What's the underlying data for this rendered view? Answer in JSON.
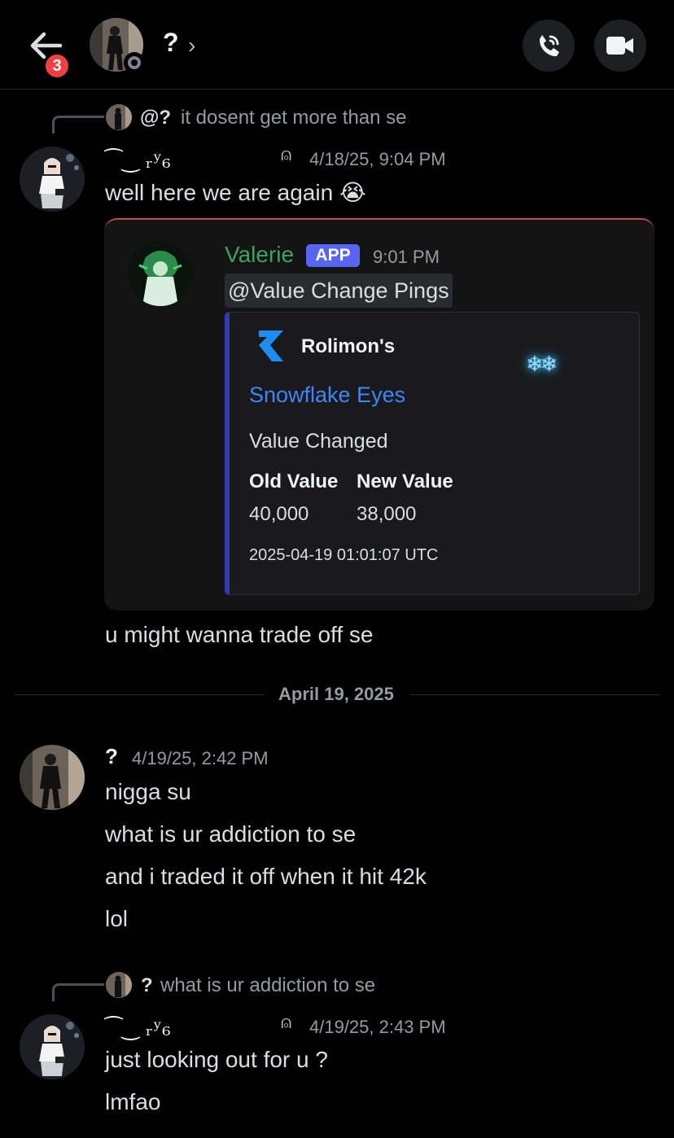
{
  "header": {
    "badge_count": "3",
    "dm_name": "?",
    "chevron": "›"
  },
  "messages": [
    {
      "reply": {
        "name": "@?",
        "text": "it dosent get more than se"
      },
      "user": "⁀‿ ᵣʸ₆",
      "user_deco": "⍝",
      "timestamp": "4/18/25, 9:04 PM",
      "lines": [
        "well here we are again 😭"
      ],
      "embed": {
        "bot_name": "Valerie",
        "bot_tag": "APP",
        "bot_time": "9:01 PM",
        "mention": "@Value Change Pings",
        "provider": "Rolimon's",
        "title": "Snowflake Eyes",
        "snow_glyph": "❄❄",
        "description": "Value Changed",
        "fields": [
          {
            "name": "Old Value",
            "value": "40,000"
          },
          {
            "name": "New Value",
            "value": "38,000"
          }
        ],
        "footer": "2025-04-19 01:01:07 UTC",
        "accent": "#3539b5"
      },
      "after": "u might wanna trade off se"
    },
    {
      "user": "?",
      "timestamp": "4/19/25, 2:42 PM",
      "lines": [
        "nigga su",
        "what is ur addiction to se",
        "and i traded it off when it hit 42k",
        "lol"
      ]
    },
    {
      "reply": {
        "name": "?",
        "text": "what is ur addiction to se"
      },
      "user": "⁀‿ ᵣʸ₆",
      "user_deco": "⍝",
      "timestamp": "4/19/25, 2:43 PM",
      "lines": [
        "just looking out for u ?",
        "lmfao"
      ]
    }
  ],
  "date_divider": "April 19, 2025",
  "icons": {
    "back": "arrow-left-icon",
    "call": "phone-call-icon",
    "video": "video-camera-icon"
  }
}
